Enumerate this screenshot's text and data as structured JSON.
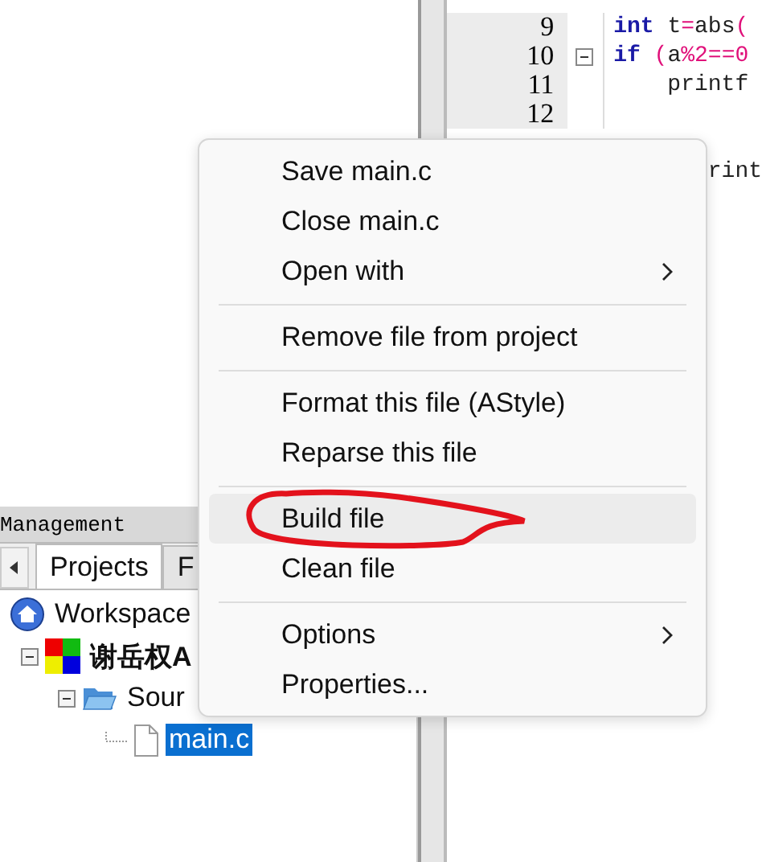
{
  "editor": {
    "lines": [
      {
        "number": "9",
        "segments": [
          {
            "kind": "keyword",
            "text": "int"
          },
          {
            "kind": "plain",
            "text": " t"
          },
          {
            "kind": "operator",
            "text": "="
          },
          {
            "kind": "plain",
            "text": "abs"
          },
          {
            "kind": "operator",
            "text": "("
          }
        ]
      },
      {
        "number": "10",
        "fold": true,
        "segments": [
          {
            "kind": "keyword",
            "text": "if"
          },
          {
            "kind": "operator",
            "text": " ("
          },
          {
            "kind": "plain",
            "text": "a"
          },
          {
            "kind": "operator",
            "text": "%"
          },
          {
            "kind": "number",
            "text": "2"
          },
          {
            "kind": "operator",
            "text": "=="
          },
          {
            "kind": "number",
            "text": "0"
          }
        ]
      },
      {
        "number": "11",
        "segments": [
          {
            "kind": "plain",
            "text": "    printf"
          }
        ]
      },
      {
        "number": "12"
      },
      {
        "segments": [
          {
            "kind": "plain",
            "text": "       rint"
          }
        ]
      }
    ]
  },
  "management": {
    "title": "Management",
    "tabs": [
      {
        "label": "Projects",
        "selected": true
      },
      {
        "label": "F",
        "selected": false
      }
    ],
    "tree": [
      {
        "label": "Workspace",
        "kind": "workspace",
        "selected": false,
        "children": [
          {
            "label": "谢岳权A",
            "kind": "project",
            "expanded": true,
            "selected": false,
            "children": [
              {
                "label": "Sour",
                "kind": "folder",
                "expanded": true,
                "selected": false,
                "children": [
                  {
                    "label": "main.c",
                    "kind": "file",
                    "selected": true
                  }
                ]
              }
            ]
          }
        ]
      }
    ]
  },
  "context_menu": {
    "items": [
      {
        "kind": "item",
        "label": "Save main.c",
        "selected": false
      },
      {
        "kind": "item",
        "label": "Close main.c",
        "selected": false
      },
      {
        "kind": "item",
        "label": "Open with",
        "submenu": true,
        "selected": false
      },
      {
        "kind": "separator"
      },
      {
        "kind": "item",
        "label": "Remove file from project",
        "selected": false
      },
      {
        "kind": "separator"
      },
      {
        "kind": "item",
        "label": "Format this file (AStyle)",
        "selected": false
      },
      {
        "kind": "item",
        "label": "Reparse this file",
        "selected": false
      },
      {
        "kind": "separator"
      },
      {
        "kind": "item",
        "label": "Build file",
        "selected": true,
        "circled": true
      },
      {
        "kind": "item",
        "label": "Clean file",
        "selected": false
      },
      {
        "kind": "separator"
      },
      {
        "kind": "item",
        "label": "Options",
        "submenu": true,
        "selected": false
      },
      {
        "kind": "item",
        "label": "Properties...",
        "selected": false
      }
    ]
  }
}
